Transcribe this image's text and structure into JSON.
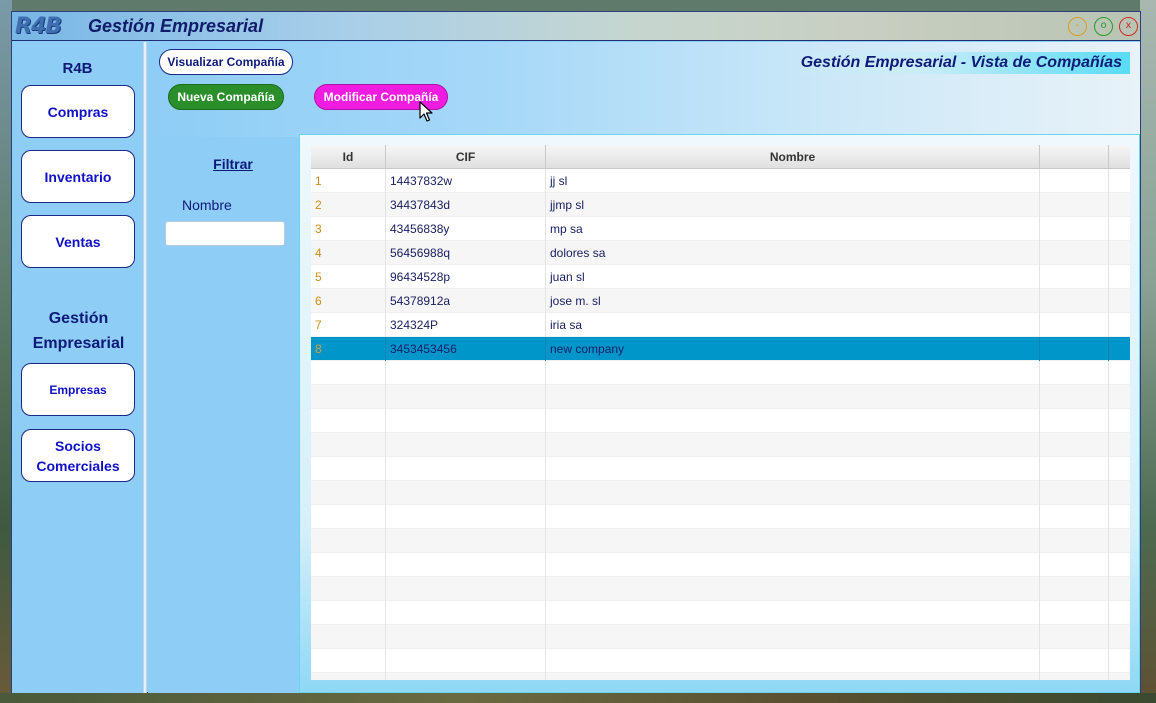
{
  "window": {
    "logo": "R4B",
    "title": "Gestión Empresarial",
    "controls": {
      "minimize": "-",
      "maximize": "o",
      "close": "x"
    }
  },
  "sidebar": {
    "header": "R4B",
    "buttons": [
      {
        "label": "Compras"
      },
      {
        "label": "Inventario"
      },
      {
        "label": "Ventas"
      }
    ],
    "section_title": "Gestión Empresarial",
    "section_buttons": [
      {
        "label": "Empresas"
      },
      {
        "label": "Socios Comerciales"
      }
    ]
  },
  "main": {
    "header_title": "Gestión Empresarial - Vista de Compañías",
    "buttons": {
      "visualizar": "Visualizar Compañía",
      "nueva": "Nueva Compañía",
      "modificar": "Modificar Compañía"
    },
    "filter": {
      "title": "Filtrar",
      "label": "Nombre",
      "value": ""
    }
  },
  "table": {
    "columns": [
      "Id",
      "CIF",
      "Nombre",
      ""
    ],
    "rows": [
      {
        "id": "1",
        "cif": "14437832w",
        "nombre": "jj sl"
      },
      {
        "id": "2",
        "cif": "34437843d",
        "nombre": "jjmp sl"
      },
      {
        "id": "3",
        "cif": "43456838y",
        "nombre": "mp sa"
      },
      {
        "id": "4",
        "cif": "56456988q",
        "nombre": "dolores sa"
      },
      {
        "id": "5",
        "cif": "96434528p",
        "nombre": "juan sl"
      },
      {
        "id": "6",
        "cif": "54378912a",
        "nombre": "jose m. sl"
      },
      {
        "id": "7",
        "cif": "324324P",
        "nombre": "iria sa"
      },
      {
        "id": "8",
        "cif": "3453453456",
        "nombre": "new company"
      }
    ],
    "selected_id": "8"
  },
  "colors": {
    "sidebar_bg": "#8ecdf6",
    "nueva_button": "#2a8f2a",
    "modificar_button": "#f01ce0",
    "selected_row": "#0096c9"
  }
}
